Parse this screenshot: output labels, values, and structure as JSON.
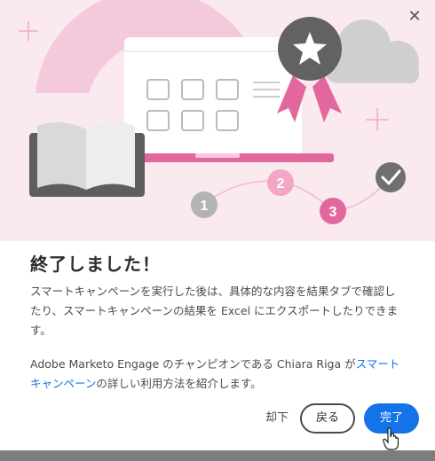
{
  "dialog": {
    "title": "終了しました！",
    "paragraph1": "スマートキャンペーンを実行した後は、具体的な内容を結果タブで確認したり、スマートキャンペーンの結果を Excel にエクスポートしたりできます。",
    "paragraph2_prefix": "Adobe Marketo Engage のチャンピオンである Chiara Riga が",
    "paragraph2_link": "スマートキャンペーン",
    "paragraph2_suffix": "の詳しい利用方法を紹介します。",
    "close_icon": "close-icon"
  },
  "illustration": {
    "steps": [
      "1",
      "2",
      "3"
    ],
    "icons": [
      "book-icon",
      "browser-window-icon",
      "award-badge-icon",
      "cloud-icon",
      "checkmark-icon"
    ]
  },
  "buttons": {
    "skip": "却下",
    "back": "戻る",
    "done": "完了"
  },
  "colors": {
    "accent": "#1473e6",
    "pink": "#e2679f",
    "hero_bg": "#fbe9f0"
  }
}
